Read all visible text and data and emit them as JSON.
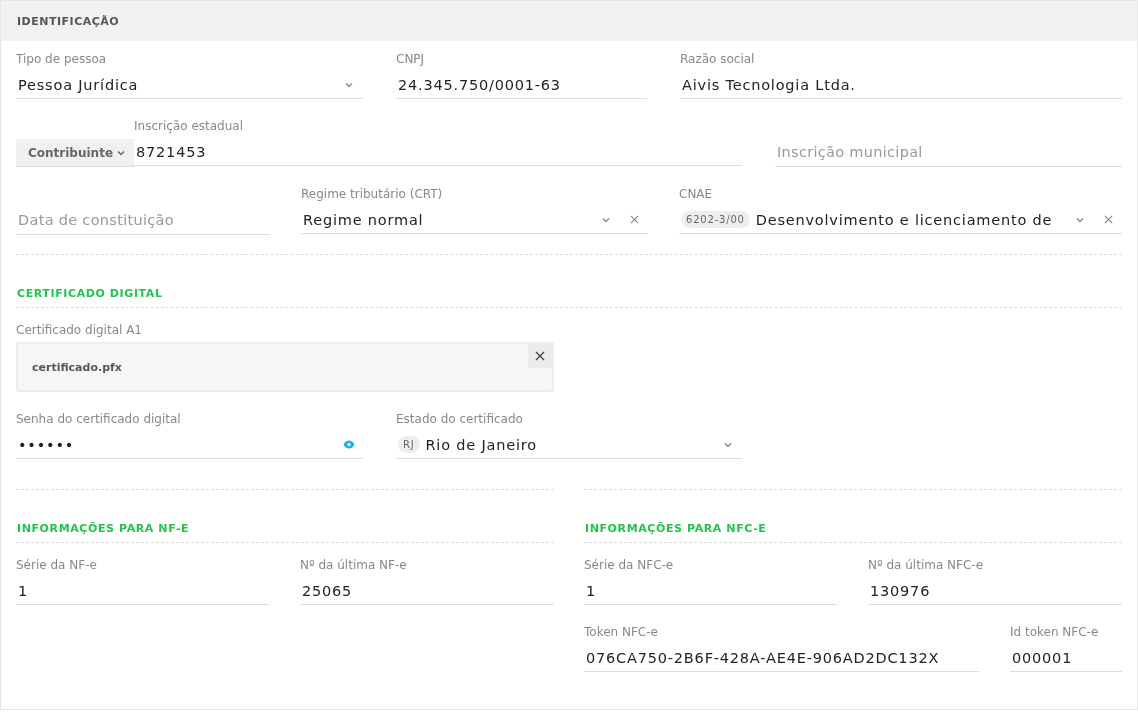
{
  "header": {
    "title": "IDENTIFICAÇÃO"
  },
  "identification": {
    "rows": [
      [
        {
          "kind": "select",
          "label": "Tipo de pessoa",
          "value": "Pessoa Jurídica",
          "clearable": false
        },
        {
          "kind": "text",
          "label": "CNPJ",
          "value": "24.345.750/0001-63"
        },
        {
          "kind": "text",
          "label": "Razão social",
          "value": "Aivis Tecnologia Ltda."
        }
      ],
      [
        {
          "kind": "text",
          "label": "Inscrição estadual",
          "prefix": "Contribuinte",
          "value": "8721453"
        },
        {
          "kind": "text",
          "placeholder": "Inscrição municipal"
        }
      ],
      [
        {
          "kind": "text",
          "placeholder": "Data de constituição"
        },
        {
          "kind": "select",
          "label": "Regime tributário (CRT)",
          "value": "Regime normal",
          "clearable": true
        },
        {
          "kind": "select",
          "label": "CNAE",
          "tag": "6202-3/00",
          "value": "Desenvolvimento e licenciamento de",
          "clearable": true
        }
      ]
    ]
  },
  "certificate": {
    "title": "CERTIFICADO DIGITAL",
    "file_label": "Certificado digital A1",
    "file_name": "certificado.pfx",
    "rows": [
      [
        {
          "kind": "password",
          "label": "Senha do certificado digital",
          "value": "••••••"
        },
        {
          "kind": "select",
          "label": "Estado do certificado",
          "tag": "RJ",
          "value": "Rio de Janeiro",
          "clearable": false
        }
      ]
    ]
  },
  "nfe": {
    "title": "INFORMAÇÕES PARA NF-E",
    "rows": [
      [
        {
          "kind": "text",
          "label": "Série da NF-e",
          "value": "1"
        },
        {
          "kind": "text",
          "label": "Nº da última NF-e",
          "value": "25065"
        }
      ]
    ]
  },
  "nfce": {
    "title": "INFORMAÇÕES PARA NFC-E",
    "rows": [
      [
        {
          "kind": "text",
          "label": "Série da NFC-e",
          "value": "1"
        },
        {
          "kind": "text",
          "label": "Nº da última NFC-e",
          "value": "130976"
        }
      ]
    ],
    "token_fields": [
      {
        "kind": "text",
        "label": "Token NFC-e",
        "value": "076CA750-2B6F-428A-AE4E-906AD2DC132X"
      },
      {
        "kind": "text",
        "label": "Id token NFC-e",
        "value": "000001"
      }
    ]
  }
}
